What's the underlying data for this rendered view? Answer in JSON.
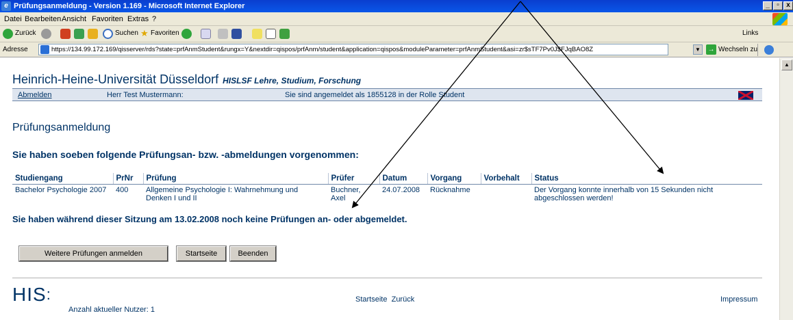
{
  "window": {
    "title": "Prüfungsanmeldung - Version 1.169 - Microsoft Internet Explorer"
  },
  "menu": [
    "Datei",
    "Bearbeiten",
    "Ansicht",
    "Favoriten",
    "Extras",
    "?"
  ],
  "toolbar": {
    "back": "Zurück",
    "search": "Suchen",
    "favorites": "Favoriten",
    "links": "Links"
  },
  "address": {
    "label": "Adresse",
    "url": "https://134.99.172.169/qisserver/rds?state=prfAnmStudent&rungx=Y&nextdir=qispos/prfAnm/student&application=qispos&moduleParameter=prfAnmStudent&asi=zr$sTF7Pv0J$FJqBAO8Z",
    "go": "Wechseln zu"
  },
  "header": {
    "university": "Heinrich-Heine-Universität Düsseldorf",
    "system": "HISLSF Lehre, Studium, Forschung"
  },
  "status": {
    "logout": "Abmelden",
    "user": "Herr Test Mustermann:",
    "role": "Sie sind angemeldet als 1855128 in der Rolle Student"
  },
  "main": {
    "title": "Prüfungsanmeldung",
    "subtitle": "Sie haben soeben folgende Prüfungsan- bzw. -abmeldungen vorgenommen:",
    "columns": [
      "Studiengang",
      "PrNr",
      "Prüfung",
      "Prüfer",
      "Datum",
      "Vorgang",
      "Vorbehalt",
      "Status"
    ],
    "row": {
      "studiengang": "Bachelor Psychologie 2007",
      "prnr": "400",
      "pruefung": "Allgemeine Psychologie I: Wahrnehmung und Denken I und II",
      "pruefer": "Buchner, Axel",
      "datum": "24.07.2008",
      "vorgang": "Rücknahme",
      "vorbehalt": "",
      "status": "Der Vorgang konnte innerhalb von 15 Sekunden nicht abgeschlossen werden!"
    },
    "session_message": "Sie haben während dieser Sitzung am 13.02.2008 noch keine Prüfungen an- oder abgemeldet."
  },
  "buttons": {
    "more": "Weitere Prüfungen anmelden",
    "home": "Startseite",
    "quit": "Beenden"
  },
  "footer": {
    "logo": "HIS",
    "users": "Anzahl aktueller Nutzer: 1",
    "link_home": "Startseite",
    "link_back": "Zurück",
    "impressum": "Impressum"
  }
}
